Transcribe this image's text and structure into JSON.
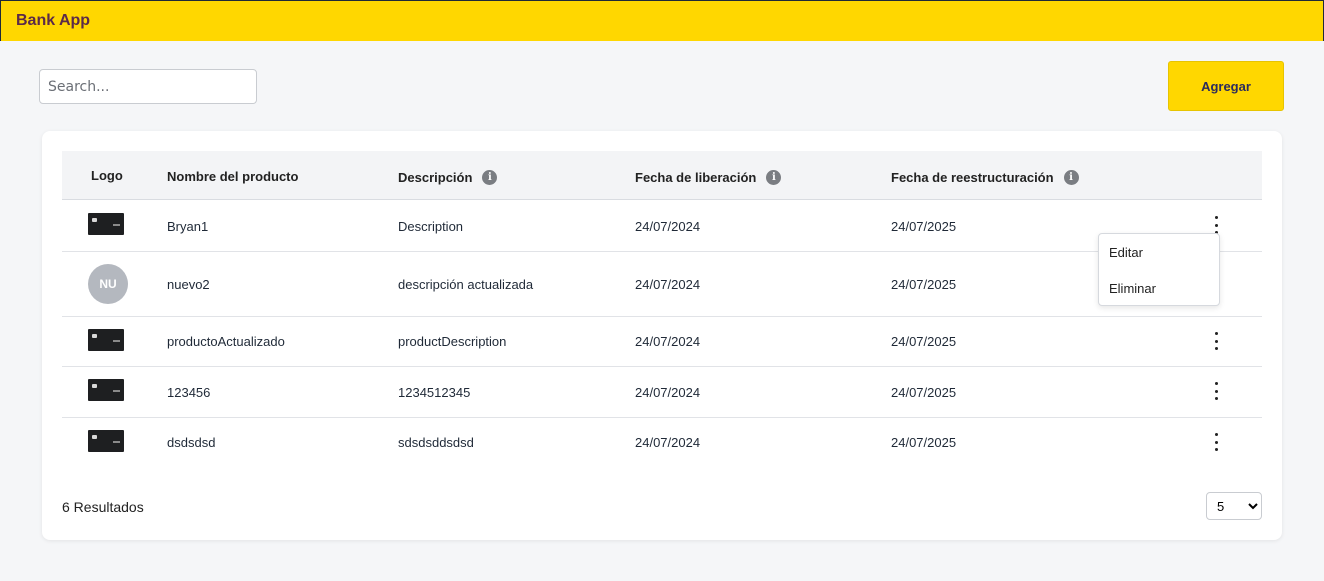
{
  "app": {
    "title": "Bank App"
  },
  "search": {
    "placeholder": "Search..."
  },
  "toolbar": {
    "add_label": "Agregar"
  },
  "table": {
    "columns": {
      "logo": "Logo",
      "name": "Nombre del producto",
      "description": "Descripción",
      "release": "Fecha de liberación",
      "revision": "Fecha de reestructuración"
    },
    "rows": [
      {
        "logo": "card-image",
        "name": "Bryan1",
        "description": "Description",
        "release": "24/07/2024",
        "revision": "24/07/2025"
      },
      {
        "logo": "NU",
        "name": "nuevo2",
        "description": "descripción actualizada",
        "release": "24/07/2024",
        "revision": "24/07/2025"
      },
      {
        "logo": "card-image",
        "name": "productoActualizado",
        "description": "productDescription",
        "release": "24/07/2024",
        "revision": "24/07/2025"
      },
      {
        "logo": "card-image",
        "name": "123456",
        "description": "1234512345",
        "release": "24/07/2024",
        "revision": "24/07/2025"
      },
      {
        "logo": "card-image",
        "name": "dsdsdsd",
        "description": "sdsdsddsdsd",
        "release": "24/07/2024",
        "revision": "24/07/2025"
      }
    ]
  },
  "menu": {
    "edit": "Editar",
    "delete": "Eliminar"
  },
  "footer": {
    "results": "6 Resultados",
    "page_size": "5"
  },
  "icons": {
    "info": "info-icon",
    "kebab": "more-vertical-icon"
  },
  "colors": {
    "accent": "#ffd700",
    "title": "#5b2a49",
    "avatar": "#b4b8bf"
  }
}
